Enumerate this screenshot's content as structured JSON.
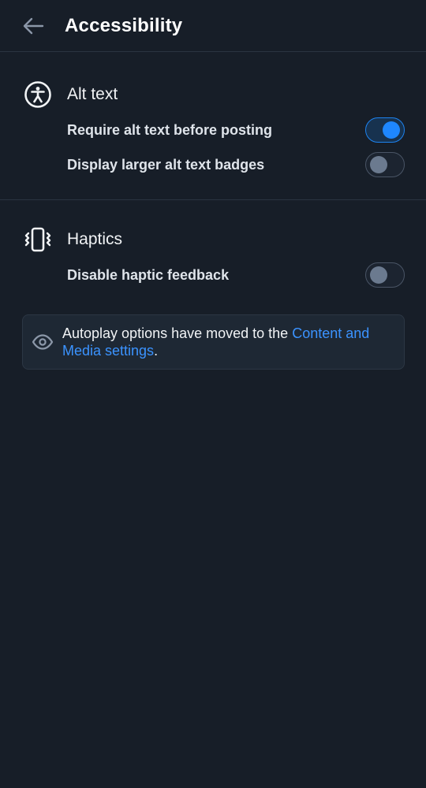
{
  "header": {
    "title": "Accessibility",
    "back_icon": "arrow-left-icon"
  },
  "alt_text": {
    "icon": "accessibility-icon",
    "title": "Alt text",
    "settings": [
      {
        "label": "Require alt text before posting",
        "enabled": true
      },
      {
        "label": "Display larger alt text badges",
        "enabled": false
      }
    ]
  },
  "haptics": {
    "icon": "phone-vibrate-icon",
    "title": "Haptics",
    "settings": [
      {
        "label": "Disable haptic feedback",
        "enabled": false
      }
    ]
  },
  "notice": {
    "icon": "eye-icon",
    "text_before": "Autoplay options have moved to the ",
    "link_text": "Content and Media settings",
    "text_after": "."
  },
  "colors": {
    "background": "#171e28",
    "accent": "#1e87ff",
    "link": "#3b93ff"
  }
}
